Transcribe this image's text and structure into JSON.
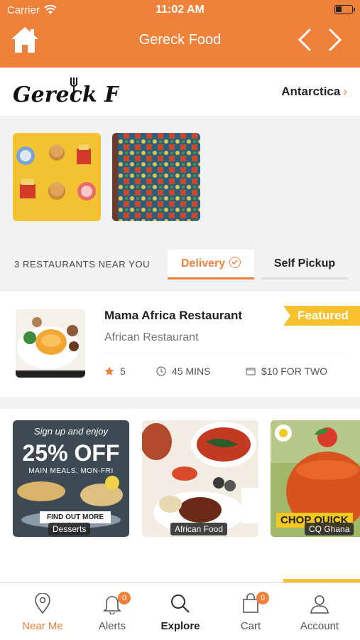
{
  "status_bar": {
    "carrier": "Carrier",
    "time": "11:02 AM"
  },
  "nav": {
    "title": "Gereck Food",
    "home_icon": "home-icon",
    "back_icon": "chevron-left-icon",
    "forward_icon": "chevron-right-icon"
  },
  "header": {
    "logo_text": "Gereck Food",
    "location": "Antarctica"
  },
  "near_you": {
    "count_text": "3 RESTAURANTS NEAR YOU",
    "tabs": [
      {
        "label": "Delivery",
        "active": true
      },
      {
        "label": "Self Pickup",
        "active": false
      }
    ]
  },
  "restaurant": {
    "name": "Mama Africa Restaurant",
    "category": "African Restaurant",
    "badge": "Featured",
    "rating": "5",
    "time": "45 MINS",
    "price": "$10 FOR TWO"
  },
  "promos": [
    {
      "label": "Desserts",
      "headline_small": "Sign up and enjoy",
      "headline_big": "25% OFF",
      "sub": "MAIN MEALS, MON-FRI",
      "cta": "FIND OUT MORE"
    },
    {
      "label": "African Food"
    },
    {
      "label": "CQ Ghana",
      "brand": "CHOP QUICK"
    }
  ],
  "tabbar": {
    "items": [
      {
        "label": "Near Me",
        "icon": "location-pin-icon",
        "active": true
      },
      {
        "label": "Alerts",
        "icon": "bell-icon",
        "badge": "0"
      },
      {
        "label": "Explore",
        "icon": "search-icon"
      },
      {
        "label": "Cart",
        "icon": "cart-icon",
        "badge": "0"
      },
      {
        "label": "Account",
        "icon": "user-icon"
      }
    ]
  },
  "colors": {
    "accent": "#f0813a",
    "featured": "#f7c22e"
  }
}
